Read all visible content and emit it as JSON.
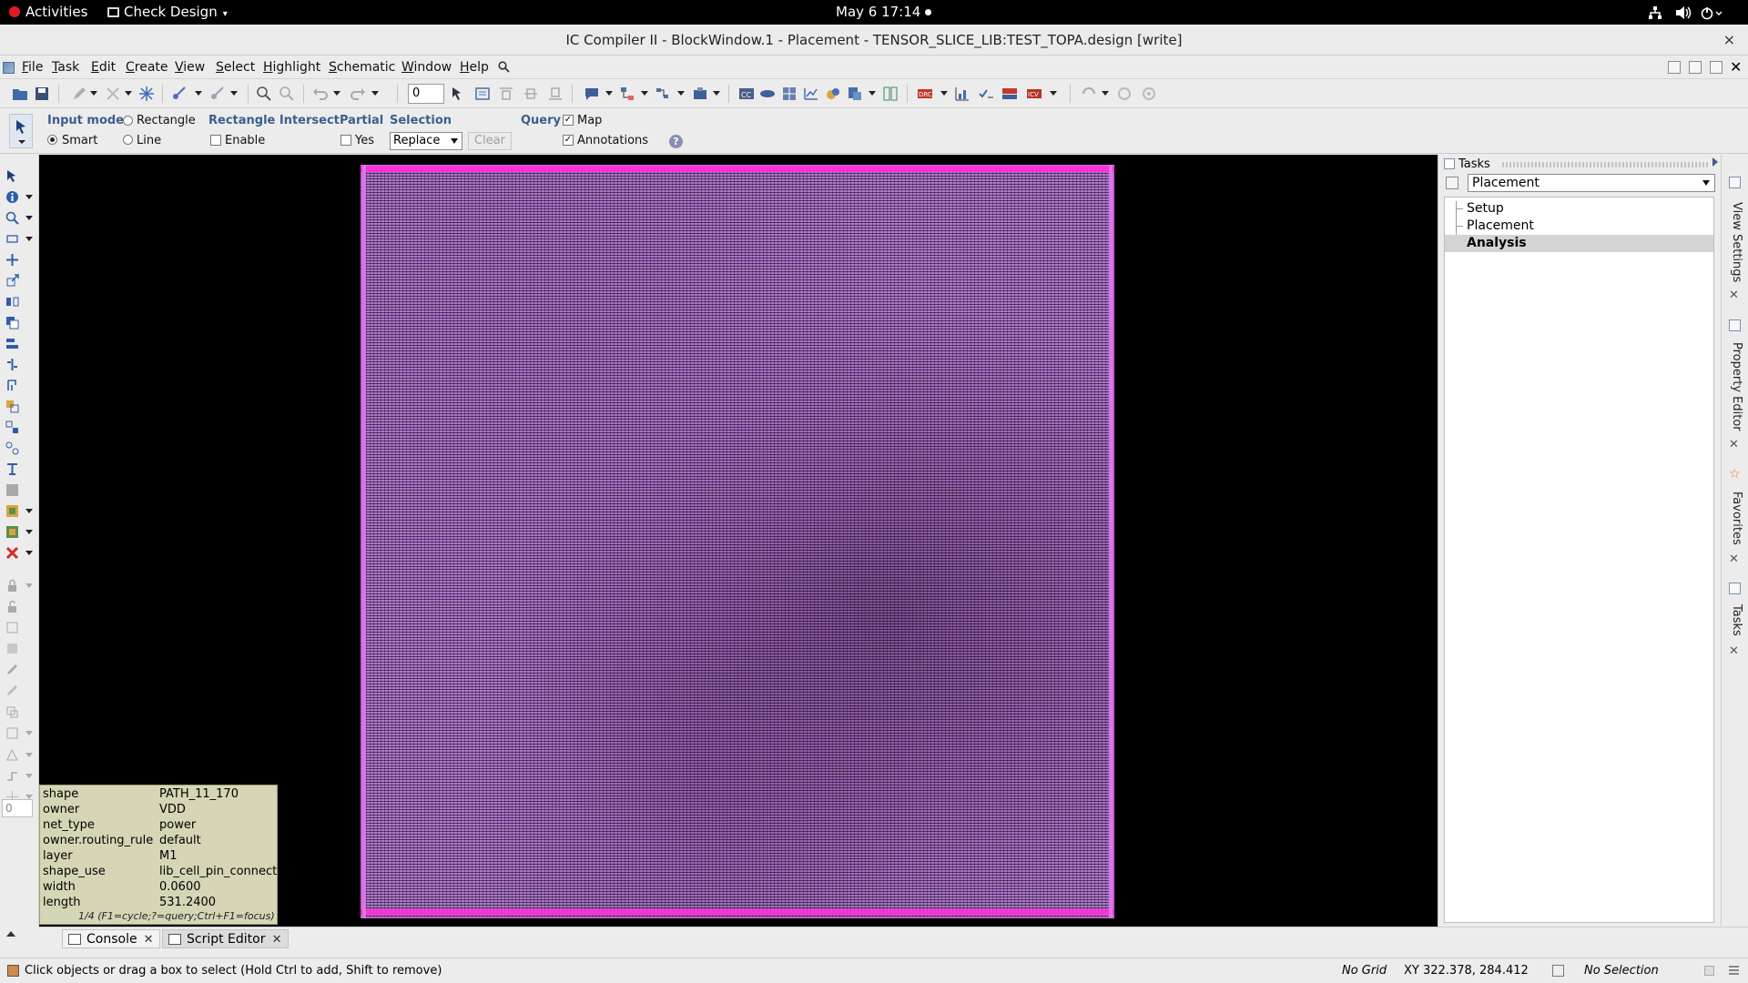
{
  "system_bar": {
    "activities": "Activities",
    "app_menu": "Check Design",
    "clock": "May 6  17:14",
    "icons": [
      "network-icon",
      "volume-icon",
      "power-icon"
    ]
  },
  "window": {
    "title": "IC Compiler II - BlockWindow.1 - Placement - TENSOR_SLICE_LIB:TEST_TOPA.design [write]",
    "close": "×"
  },
  "menu": {
    "items": [
      {
        "label": "File",
        "mnemonic": "F",
        "rest": "ile"
      },
      {
        "label": "Task",
        "mnemonic": "T",
        "rest": "ask"
      },
      {
        "label": "Edit",
        "mnemonic": "E",
        "rest": "dit"
      },
      {
        "label": "Create",
        "mnemonic": "C",
        "rest": "reate"
      },
      {
        "label": "View",
        "mnemonic": "V",
        "rest": "iew"
      },
      {
        "label": "Select",
        "mnemonic": "S",
        "rest": "elect"
      },
      {
        "label": "Highlight",
        "mnemonic": "H",
        "rest": "ighlight"
      },
      {
        "label": "Schematic",
        "mnemonic": "S",
        "rest": "chematic"
      },
      {
        "label": "Window",
        "mnemonic": "W",
        "rest": "indow"
      },
      {
        "label": "Help",
        "mnemonic": "H",
        "rest": "elp"
      }
    ]
  },
  "toolbar": {
    "spin_value": "0"
  },
  "options": {
    "input_mode_label": "Input mode",
    "rectangle": "Rectangle",
    "smart": "Smart",
    "line": "Line",
    "rect_intersect_label": "Rectangle Intersect",
    "enable": "Enable",
    "partial_label": "Partial",
    "yes": "Yes",
    "selection_label": "Selection",
    "selection_value": "Replace",
    "clear": "Clear",
    "query_label": "Query",
    "map": "Map",
    "annotations": "Annotations",
    "help": "?",
    "smart_selected": true,
    "map_checked": true,
    "annotations_checked": true,
    "enable_checked": false,
    "yes_checked": false
  },
  "query_panel": {
    "rows": [
      {
        "key": "shape",
        "value": "PATH_11_170"
      },
      {
        "key": "owner",
        "value": "VDD"
      },
      {
        "key": "net_type",
        "value": "power"
      },
      {
        "key": "owner.routing_rule",
        "value": "default"
      },
      {
        "key": "layer",
        "value": "M1"
      },
      {
        "key": "shape_use",
        "value": "lib_cell_pin_connect"
      },
      {
        "key": "width",
        "value": "0.0600"
      },
      {
        "key": "length",
        "value": "531.2400"
      }
    ],
    "footer": "1/4 (F1=cycle;?=query;Ctrl+F1=focus)"
  },
  "left_tools": {
    "input_value": "0"
  },
  "tasks_panel": {
    "header": "Tasks",
    "selected_task": "Placement",
    "tree": [
      {
        "label": "Setup",
        "selected": false
      },
      {
        "label": "Placement",
        "selected": false
      },
      {
        "label": "Analysis",
        "selected": true
      }
    ]
  },
  "side_tabs": [
    {
      "label": "View Settings",
      "icon": "view-settings-icon"
    },
    {
      "label": "Property Editor",
      "icon": "property-editor-icon"
    },
    {
      "label": "Favorites",
      "icon": "star-icon"
    },
    {
      "label": "Tasks",
      "icon": "tasks-icon"
    }
  ],
  "console_tabs": [
    {
      "label": "Console",
      "active": false
    },
    {
      "label": "Script Editor",
      "active": true
    }
  ],
  "status": {
    "message": "Click objects or drag a box to select (Hold Ctrl to add, Shift to remove)",
    "grid": "No Grid",
    "xy": "XY 322.378, 284.412",
    "selection": "No Selection"
  },
  "colors": {
    "die_fill": "#b07ad0",
    "power_rail": "#ff2fd6",
    "canvas_bg": "#000000",
    "query_bg": "#d6d6b6",
    "option_heading": "#3c5e8a"
  }
}
